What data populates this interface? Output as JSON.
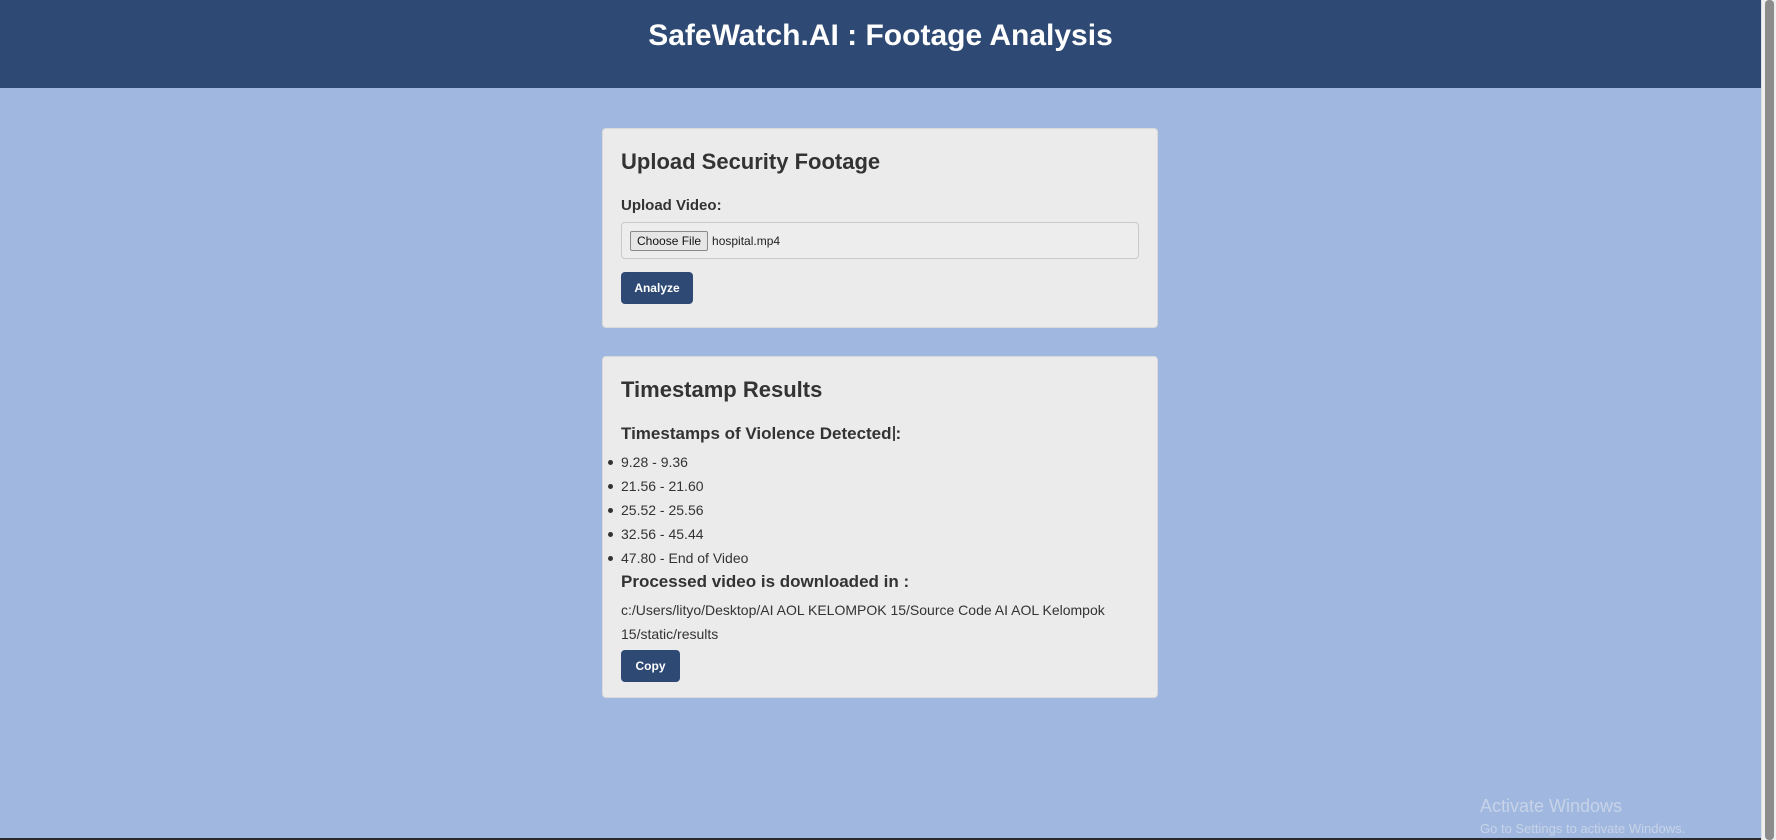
{
  "header": {
    "title": "SafeWatch.AI : Footage Analysis"
  },
  "upload": {
    "title": "Upload Security Footage",
    "label": "Upload Video:",
    "choose_file_label": "Choose File",
    "file_name": "hospital.mp4",
    "analyze_label": "Analyze"
  },
  "results": {
    "title": "Timestamp Results",
    "timestamps_heading": "Timestamps of Violence Detected",
    "timestamps_colon": ":",
    "timestamps": [
      "9.28 - 9.36",
      "21.56 - 21.60",
      "25.52 - 25.56",
      "32.56 - 45.44",
      "47.80 - End of Video"
    ],
    "processed_heading": "Processed video is downloaded in :",
    "path": "c:/Users/lityo/Desktop/AI AOL KELOMPOK 15/Source Code AI AOL Kelompok 15/static/results",
    "copy_label": "Copy"
  },
  "watermark": {
    "line1": "Activate Windows",
    "line2": "Go to Settings to activate Windows."
  },
  "colors": {
    "header_bg": "#2e4a74",
    "page_bg": "#a0b8df",
    "card_bg": "#ebebeb",
    "button_bg": "#2e4a74"
  }
}
